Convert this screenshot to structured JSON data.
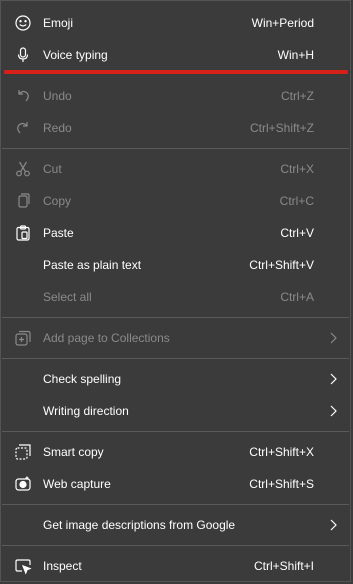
{
  "menu": {
    "emoji": {
      "label": "Emoji",
      "shortcut": "Win+Period"
    },
    "voice": {
      "label": "Voice typing",
      "shortcut": "Win+H"
    },
    "undo": {
      "label": "Undo",
      "shortcut": "Ctrl+Z"
    },
    "redo": {
      "label": "Redo",
      "shortcut": "Ctrl+Shift+Z"
    },
    "cut": {
      "label": "Cut",
      "shortcut": "Ctrl+X"
    },
    "copy": {
      "label": "Copy",
      "shortcut": "Ctrl+C"
    },
    "paste": {
      "label": "Paste",
      "shortcut": "Ctrl+V"
    },
    "paste_plain": {
      "label": "Paste as plain text",
      "shortcut": "Ctrl+Shift+V"
    },
    "select_all": {
      "label": "Select all",
      "shortcut": "Ctrl+A"
    },
    "collections": {
      "label": "Add page to Collections"
    },
    "spelling": {
      "label": "Check spelling"
    },
    "writing_dir": {
      "label": "Writing direction"
    },
    "smart_copy": {
      "label": "Smart copy",
      "shortcut": "Ctrl+Shift+X"
    },
    "web_capture": {
      "label": "Web capture",
      "shortcut": "Ctrl+Shift+S"
    },
    "image_desc": {
      "label": "Get image descriptions from Google"
    },
    "inspect": {
      "label": "Inspect",
      "shortcut": "Ctrl+Shift+I"
    }
  },
  "colors": {
    "background": "#3b3b3b",
    "highlight_line": "#d6211a",
    "disabled_text": "#8a8a8a"
  }
}
